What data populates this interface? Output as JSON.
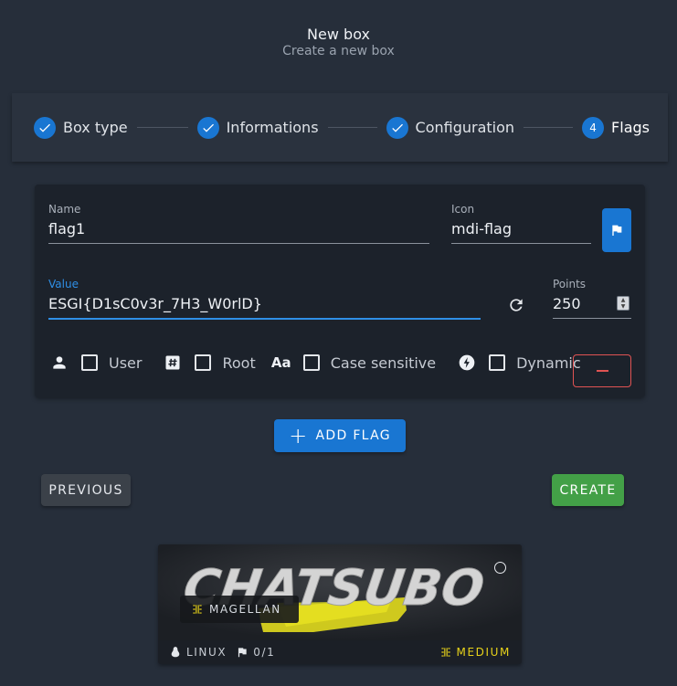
{
  "header": {
    "title": "New box",
    "subtitle": "Create a new box"
  },
  "stepper": {
    "steps": [
      {
        "label": "Box type",
        "state": "complete",
        "icon": "check-icon"
      },
      {
        "label": "Informations",
        "state": "complete",
        "icon": "check-icon"
      },
      {
        "label": "Configuration",
        "state": "complete",
        "icon": "check-icon"
      },
      {
        "label": "Flags",
        "state": "active",
        "number": "4"
      }
    ]
  },
  "flag": {
    "name_label": "Name",
    "name_value": "flag1",
    "icon_label": "Icon",
    "icon_value": "mdi-flag",
    "value_label": "Value",
    "value_value": "ESGI{D1sC0v3r_7H3_W0rlD}",
    "points_label": "Points",
    "points_value": "250",
    "options": [
      {
        "label": "User",
        "icon": "account-icon",
        "checked": false
      },
      {
        "label": "Root",
        "icon": "pound-box-icon",
        "checked": false
      },
      {
        "label": "Case sensitive",
        "icon": "format-letter-case-icon",
        "checked": false
      },
      {
        "label": "Dynamic",
        "icon": "lightning-bolt-circle-icon",
        "checked": false
      }
    ]
  },
  "actions": {
    "add_flag": "ADD FLAG",
    "previous": "PREVIOUS",
    "create": "CREATE"
  },
  "preview": {
    "logo_text": "CHATSUBO",
    "maker": "MAGELLAN",
    "os": "LINUX",
    "flags_count": "0/1",
    "difficulty": "MEDIUM"
  },
  "colors": {
    "background": "#262e3a",
    "primary": "#1976d2",
    "success": "#43a047",
    "danger": "#e05353",
    "difficulty": "#e7d21a"
  }
}
